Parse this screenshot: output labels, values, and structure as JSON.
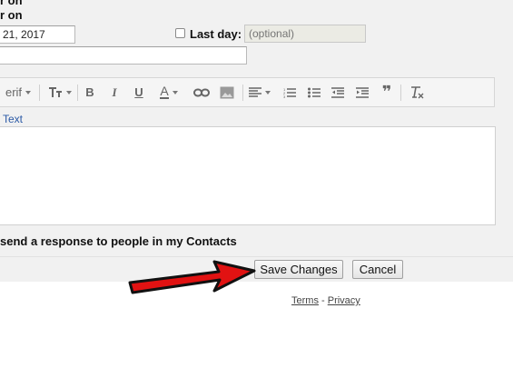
{
  "top": {
    "line1": "r on",
    "line2": "r on"
  },
  "first_day": {
    "value": "21, 2017"
  },
  "last_day": {
    "label": "Last day:",
    "placeholder": "(optional)"
  },
  "subject": {
    "value": ""
  },
  "toolbar": {
    "font_label": "erif",
    "bold": "B",
    "italic": "I",
    "underline": "U",
    "text_color": "A",
    "quote": "❞"
  },
  "plain_text_link": "Text",
  "body_text": "",
  "contacts_option": "send a response to people in my Contacts",
  "buttons": {
    "save": "Save Changes",
    "cancel": "Cancel"
  },
  "footer": {
    "terms": "Terms",
    "separator": " - ",
    "privacy": "Privacy"
  },
  "colors": {
    "panel_bg": "#f1f1f1",
    "arrow": "#e11212",
    "link": "#2b5aa6"
  },
  "icons": [
    "link-icon",
    "image-icon",
    "align-icon",
    "numbered-list-icon",
    "bulleted-list-icon",
    "indent-less-icon",
    "indent-more-icon",
    "quote-icon",
    "remove-formatting-icon"
  ]
}
